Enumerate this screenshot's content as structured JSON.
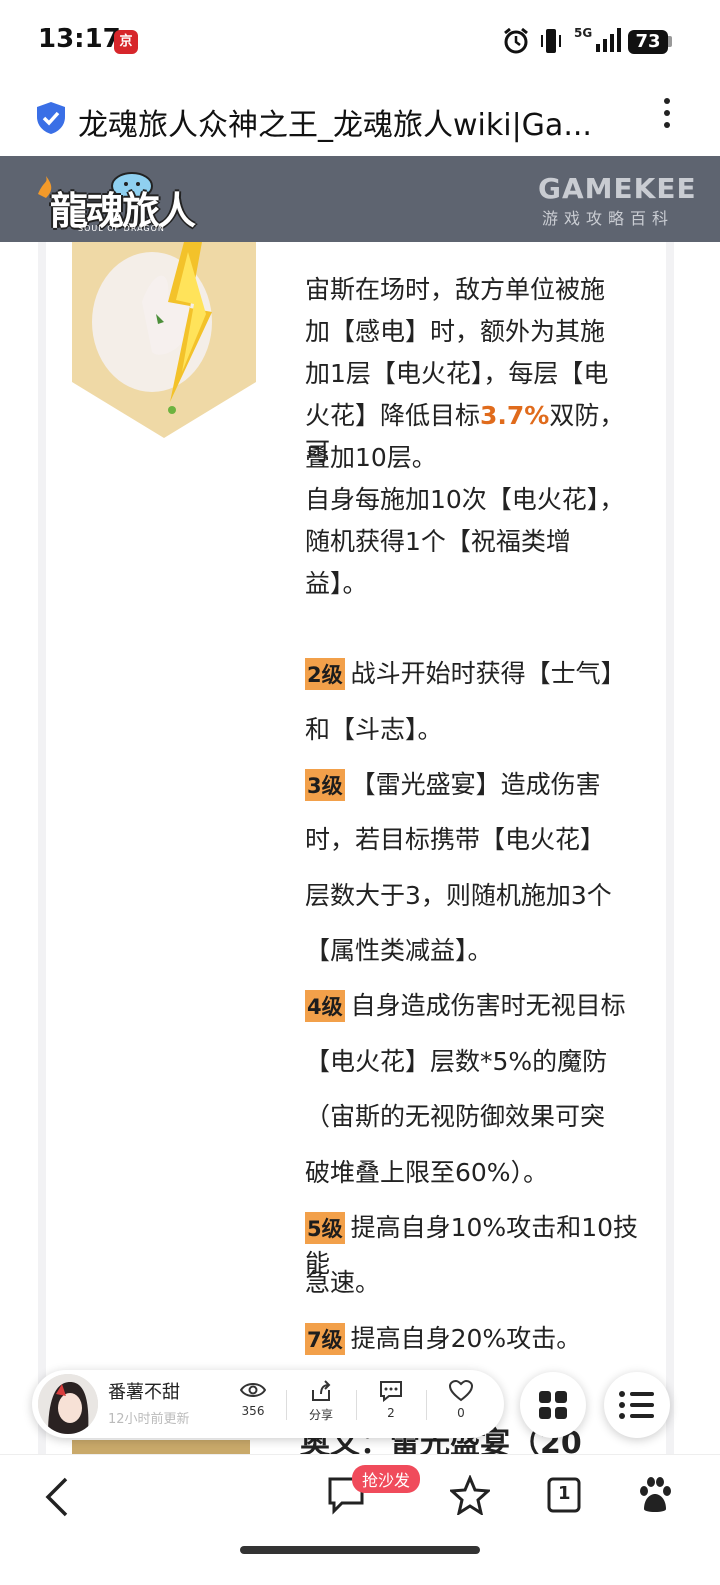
{
  "status_bar": {
    "time": "13:17",
    "app_badge": "京",
    "network": "5G",
    "battery": "73"
  },
  "browser": {
    "page_title": "龙魂旅人众神之王_龙魂旅人wiki|Ga..."
  },
  "site_header": {
    "logo_text": "龍魂旅人",
    "logo_sub": "SOUL OF DRAGON",
    "brand": "GAMEKEE",
    "brand_sub": "游戏攻略百科"
  },
  "skill": {
    "desc_1": "宙斯在场时，敌方单位被施",
    "desc_2": "加【感电】时，额外为其施",
    "desc_3": "加1层【电火花】，每层【电",
    "desc_4a": "火花】降低目标",
    "desc_4_value": "3.7%",
    "desc_4b": "双防，可",
    "desc_5": "叠加10层。",
    "desc_6": "自身每施加10次【电火花】，",
    "desc_7": "随机获得1个【祝福类增",
    "desc_8": "益】。",
    "levels": [
      {
        "tag": "2级",
        "lines": [
          "战斗开始时获得【士气】",
          "和【斗志】。"
        ]
      },
      {
        "tag": "3级",
        "lines": [
          "【雷光盛宴】造成伤害",
          "时，若目标携带【电火花】",
          "层数大于3，则随机施加3个",
          "【属性类减益】。"
        ]
      },
      {
        "tag": "4级",
        "lines": [
          "自身造成伤害时无视目标",
          "【电火花】层数*5%的魔防",
          "（宙斯的无视防御效果可突",
          "破堆叠上限至60%）。"
        ]
      },
      {
        "tag": "5级",
        "lines": [
          "提高自身10%攻击和10技能",
          "急速。"
        ]
      },
      {
        "tag": "7级",
        "lines": [
          "提高自身20%攻击。"
        ]
      }
    ],
    "next_title": "奥义：雷光盛宴（20"
  },
  "author_bar": {
    "name": "番薯不甜",
    "updated": "12小时前更新",
    "views": "356",
    "share": "分享",
    "comments": "2",
    "likes": "0"
  },
  "bottom_nav": {
    "sofa_badge": "抢沙发",
    "tab_count": "1"
  },
  "colors": {
    "header_bg": "#5e6470",
    "level_tag": "#f2a04a",
    "highlight": "#e06b1c",
    "badge_red": "#f04b5b"
  }
}
